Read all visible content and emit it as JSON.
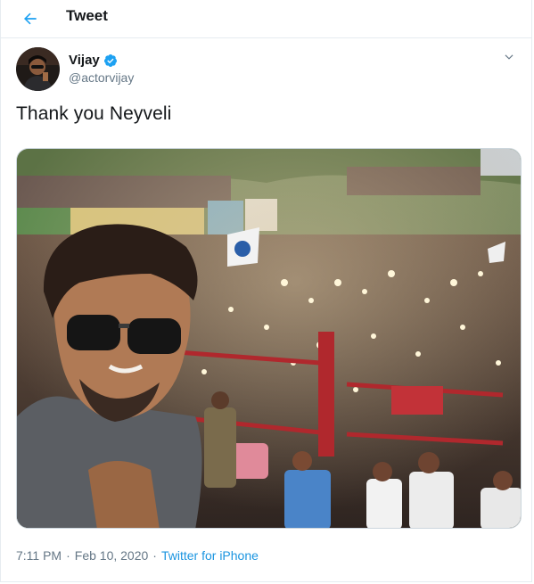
{
  "header": {
    "title": "Tweet",
    "back_icon": "back-arrow-icon"
  },
  "author": {
    "display_name": "Vijay",
    "handle": "@actorvijay",
    "verified": true,
    "menu_icon": "chevron-down-icon"
  },
  "tweet": {
    "text": "Thank you Neyveli",
    "media_description": "selfie-with-crowd-photo"
  },
  "meta": {
    "time": "7:11 PM",
    "separator": "·",
    "date": "Feb 10, 2020",
    "source": "Twitter for iPhone"
  },
  "colors": {
    "accent": "#1da1f2",
    "link": "#1b95e0",
    "secondary_text": "#657786",
    "border": "#e6ecf0"
  }
}
